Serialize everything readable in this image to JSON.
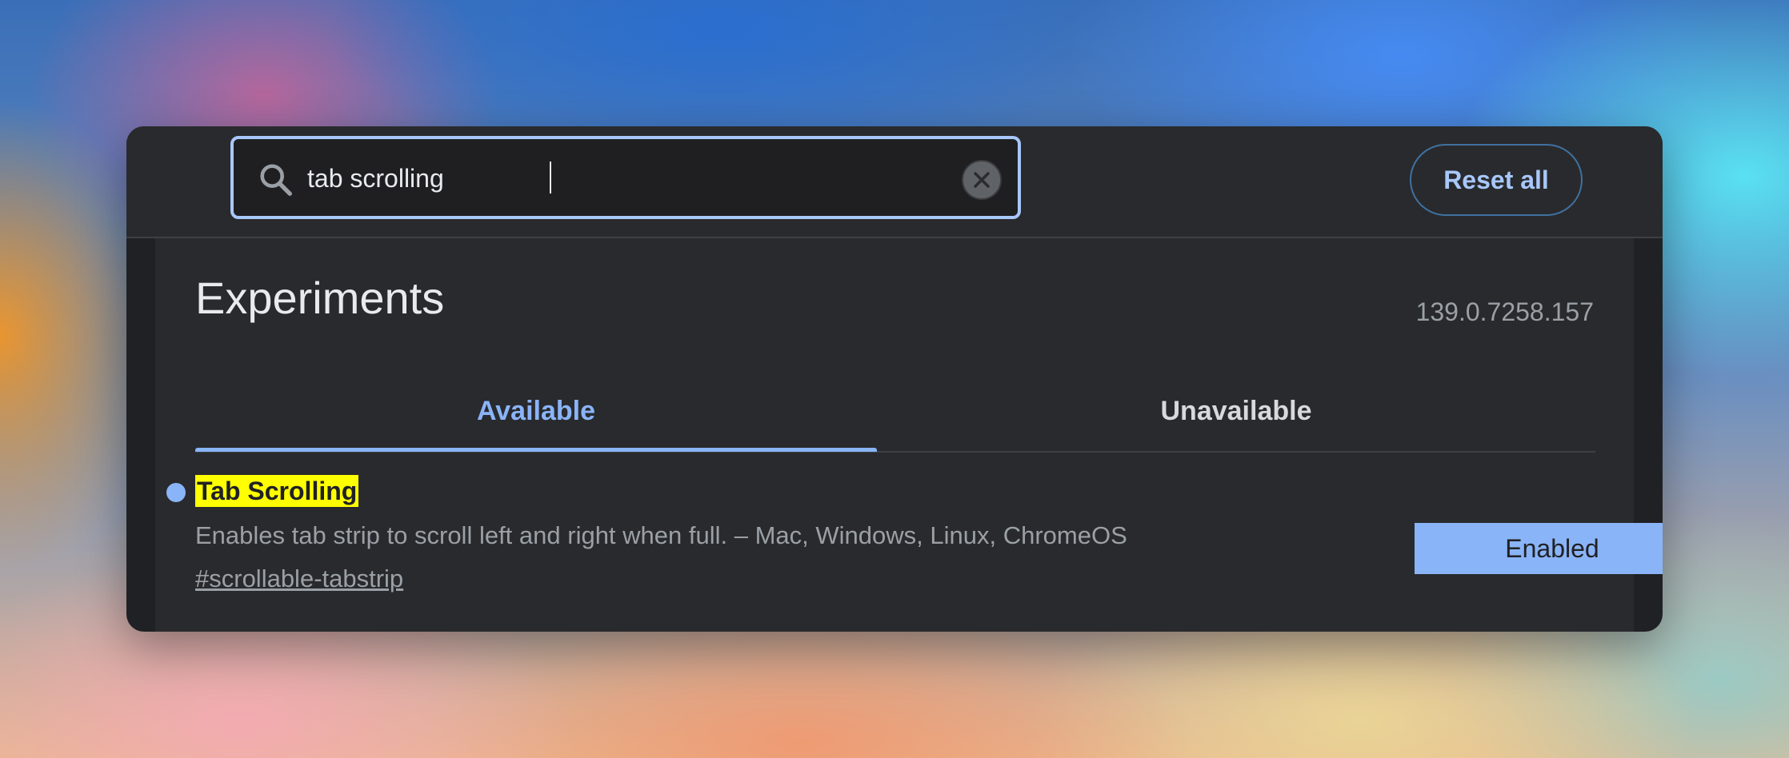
{
  "search": {
    "value": "tab scrolling",
    "clear_icon": "close-circle-icon",
    "search_icon": "search-icon"
  },
  "header": {
    "reset_label": "Reset all"
  },
  "page": {
    "title": "Experiments",
    "version": "139.0.7258.157"
  },
  "tabs": [
    {
      "label": "Available",
      "active": true
    },
    {
      "label": "Unavailable",
      "active": false
    }
  ],
  "experiment": {
    "name": "Tab Scrolling",
    "description": "Enables tab strip to scroll left and right when full. – Mac, Windows, Linux, ChromeOS",
    "link": "#scrollable-tabstrip",
    "state": "Enabled"
  },
  "colors": {
    "accent": "#8ab4f8",
    "highlight": "#ffff00",
    "background": "#202124"
  }
}
